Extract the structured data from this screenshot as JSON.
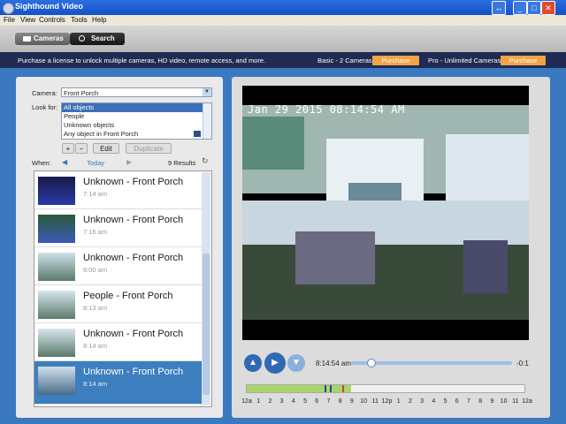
{
  "window": {
    "title": "Sighthound Video",
    "icons": [
      "app-icon",
      "minimize-icon",
      "restore-icon",
      "close-icon"
    ]
  },
  "menu": [
    "File",
    "View",
    "Controls",
    "Tools",
    "Help"
  ],
  "tabs": {
    "cameras": "Cameras",
    "search": "Search"
  },
  "banner": {
    "text": "Purchase a license to unlock multiple cameras, HD video, remote access, and more.",
    "basic_label": "Basic - 2 Cameras",
    "basic_button": "Purchase",
    "pro_label": "Pro - Unlimited Cameras",
    "pro_button": "Purchase",
    "accent": "#f0a445"
  },
  "search": {
    "camera_label": "Camera:",
    "camera_value": "Front Porch",
    "lookfor_label": "Look for:",
    "lookfor_items": [
      "All objects",
      "People",
      "Unknown objects",
      "Any object in Front Porch"
    ],
    "add": "+",
    "remove": "−",
    "edit": "Edit",
    "duplicate": "Duplicate",
    "when_label": "When:",
    "when_value": "Today",
    "results_count": "9 Results"
  },
  "results": [
    {
      "title": "Unknown - Front Porch",
      "time": "7:14 am"
    },
    {
      "title": "Unknown - Front Porch",
      "time": "7:16 am"
    },
    {
      "title": "Unknown - Front Porch",
      "time": "8:00 am"
    },
    {
      "title": "People - Front Porch",
      "time": "8:13 am"
    },
    {
      "title": "Unknown - Front Porch",
      "time": "8:14 am"
    },
    {
      "title": "Unknown - Front Porch",
      "time": "8:14 am"
    }
  ],
  "video": {
    "timestamp": "Jan 29 2015 08:14:54 AM"
  },
  "player": {
    "current_time": "8:14:54 am",
    "remaining": "-0:1",
    "progress": 0.12,
    "timeline_hours": [
      "12a",
      "1",
      "2",
      "3",
      "4",
      "5",
      "6",
      "7",
      "8",
      "9",
      "10",
      "11",
      "12p",
      "1",
      "2",
      "3",
      "4",
      "5",
      "6",
      "7",
      "8",
      "9",
      "10",
      "11",
      "12a"
    ]
  }
}
